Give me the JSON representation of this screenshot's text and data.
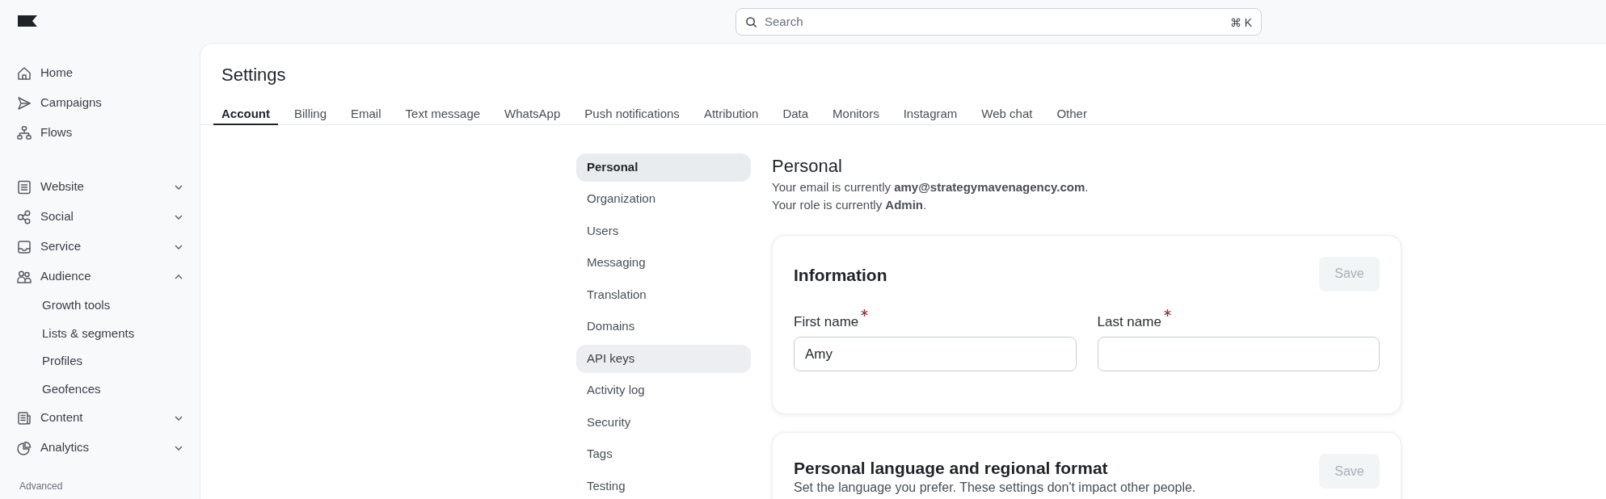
{
  "search": {
    "placeholder": "Search",
    "shortcut": "⌘ K"
  },
  "sidebar": {
    "items": [
      {
        "label": "Home",
        "kind": "link"
      },
      {
        "label": "Campaigns",
        "kind": "link"
      },
      {
        "label": "Flows",
        "kind": "link"
      },
      {
        "label": "Website",
        "kind": "group",
        "expanded": false
      },
      {
        "label": "Social",
        "kind": "group",
        "expanded": false
      },
      {
        "label": "Service",
        "kind": "group",
        "expanded": false
      },
      {
        "label": "Audience",
        "kind": "group",
        "expanded": true,
        "children": [
          {
            "label": "Growth tools"
          },
          {
            "label": "Lists & segments"
          },
          {
            "label": "Profiles"
          },
          {
            "label": "Geofences"
          }
        ]
      },
      {
        "label": "Content",
        "kind": "group",
        "expanded": false
      },
      {
        "label": "Analytics",
        "kind": "group",
        "expanded": false
      }
    ],
    "section_label": "Advanced"
  },
  "page_title": "Settings",
  "tabs": [
    {
      "label": "Account",
      "selected": true
    },
    {
      "label": "Billing",
      "selected": false
    },
    {
      "label": "Email",
      "selected": false
    },
    {
      "label": "Text message",
      "selected": false
    },
    {
      "label": "WhatsApp",
      "selected": false
    },
    {
      "label": "Push notifications",
      "selected": false
    },
    {
      "label": "Attribution",
      "selected": false
    },
    {
      "label": "Data",
      "selected": false
    },
    {
      "label": "Monitors",
      "selected": false
    },
    {
      "label": "Instagram",
      "selected": false
    },
    {
      "label": "Web chat",
      "selected": false
    },
    {
      "label": "Other",
      "selected": false
    }
  ],
  "submenu": [
    {
      "label": "Personal",
      "selected": true,
      "hovered": false
    },
    {
      "label": "Organization",
      "selected": false,
      "hovered": false
    },
    {
      "label": "Users",
      "selected": false,
      "hovered": false
    },
    {
      "label": "Messaging",
      "selected": false,
      "hovered": false
    },
    {
      "label": "Translation",
      "selected": false,
      "hovered": false
    },
    {
      "label": "Domains",
      "selected": false,
      "hovered": false
    },
    {
      "label": "API keys",
      "selected": false,
      "hovered": true
    },
    {
      "label": "Activity log",
      "selected": false,
      "hovered": false
    },
    {
      "label": "Security",
      "selected": false,
      "hovered": false
    },
    {
      "label": "Tags",
      "selected": false,
      "hovered": false
    },
    {
      "label": "Testing",
      "selected": false,
      "hovered": false
    }
  ],
  "content": {
    "heading": "Personal",
    "lines": [
      "Your email is currently **amy@strategymavenagency.com**.",
      "Your role is currently **Admin**."
    ],
    "cards": [
      {
        "title": "Information",
        "save": {
          "label": "Save",
          "disabled": true
        },
        "fields": [
          {
            "label": "First name",
            "required": true,
            "value": "Amy"
          },
          {
            "label": "Last name",
            "required": true
          }
        ]
      },
      {
        "title": "Personal language and regional format",
        "subtitle": "Set the language you prefer. These settings don't impact other people.",
        "save": {
          "label": "Save",
          "disabled": true
        }
      }
    ]
  }
}
